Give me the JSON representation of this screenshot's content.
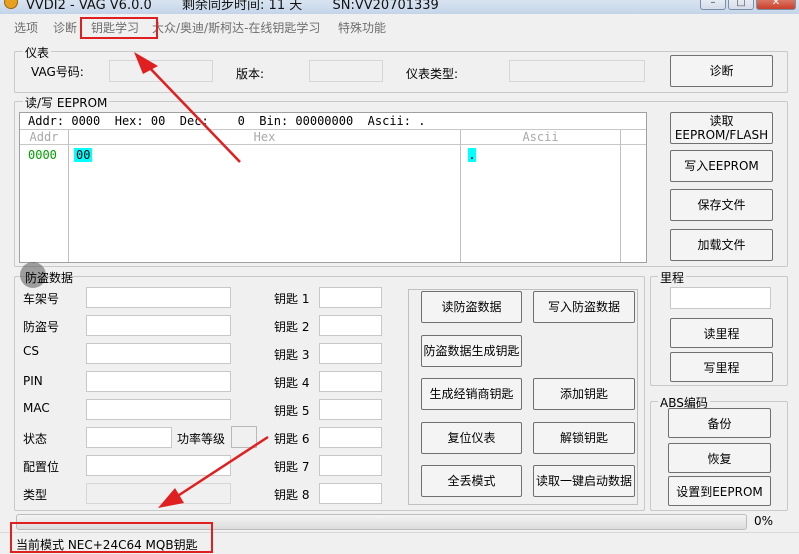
{
  "window": {
    "title": "VVDI2 - VAG V6.0.0",
    "sync_text": "剩余同步时间: 11 天",
    "serial": "SN:VV20701339"
  },
  "menu": [
    {
      "label": "选项"
    },
    {
      "label": "诊断"
    },
    {
      "label": "钥匙学习"
    },
    {
      "label": "大众/奥迪/斯柯达-在线钥匙学习"
    },
    {
      "label": "特殊功能"
    }
  ],
  "instrument": {
    "legend": "仪表",
    "vag_label": "VAG号码:",
    "vag_value": "",
    "version_label": "版本:",
    "version_value": "",
    "type_label": "仪表类型:",
    "type_value": "",
    "diagnose_button": "诊断"
  },
  "eeprom": {
    "legend": "读/写 EEPROM",
    "status": {
      "addr_label": "Addr:",
      "addr": "0000",
      "hex_label": "Hex:",
      "hex": "00",
      "dec_label": "Dec:",
      "dec": "0",
      "bin_label": "Bin:",
      "bin": "00000000",
      "ascii_label": "Ascii:",
      "ascii": "."
    },
    "columns": {
      "addr": "Addr",
      "hex": "Hex",
      "ascii": "Ascii"
    },
    "rows": [
      {
        "addr": "0000",
        "hex": "00",
        "ascii": "."
      }
    ],
    "buttons": {
      "read_line1": "读取",
      "read_line2": "EEPROM/FLASH",
      "write": "写入EEPROM",
      "save": "保存文件",
      "load": "加载文件"
    }
  },
  "immo": {
    "legend": "防盗数据",
    "fields": [
      {
        "label": "车架号",
        "value": ""
      },
      {
        "label": "防盗号",
        "value": ""
      },
      {
        "label": "CS",
        "value": ""
      },
      {
        "label": "PIN",
        "value": ""
      },
      {
        "label": "MAC",
        "value": ""
      },
      {
        "label": "状态",
        "value": ""
      },
      {
        "label": "配置位",
        "value": ""
      },
      {
        "label": "类型",
        "value": ""
      }
    ],
    "power_label": "功率等级",
    "power_value": "",
    "keys": [
      {
        "label": "钥匙 1",
        "value": ""
      },
      {
        "label": "钥匙 2",
        "value": ""
      },
      {
        "label": "钥匙 3",
        "value": ""
      },
      {
        "label": "钥匙 4",
        "value": ""
      },
      {
        "label": "钥匙 5",
        "value": ""
      },
      {
        "label": "钥匙 6",
        "value": ""
      },
      {
        "label": "钥匙 7",
        "value": ""
      },
      {
        "label": "钥匙 8",
        "value": ""
      }
    ],
    "buttons": {
      "read_immo": "读防盗数据",
      "write_immo": "写入防盗数据",
      "gen_key": "防盗数据生成钥匙",
      "gen_dealer_key": "生成经销商钥匙",
      "add_key": "添加钥匙",
      "reset_cluster": "复位仪表",
      "unlock_key": "解锁钥匙",
      "all_keys_lost": "全丢模式",
      "one_click_read": "读取一键启动数据"
    }
  },
  "mileage": {
    "legend": "里程",
    "value": "",
    "read_button": "读里程",
    "write_button": "写里程"
  },
  "abs": {
    "legend": "ABS编码",
    "backup_button": "备份",
    "restore_button": "恢复",
    "set_eeprom_button": "设置到EEPROM"
  },
  "progress": {
    "value": 0,
    "label": "0%"
  },
  "status_bar": {
    "text": "当前模式 NEC+24C64 MQB钥匙"
  },
  "colors": {
    "annotation": "#e02020",
    "addr_green": "#00a000",
    "selection_cyan": "#00ffff"
  }
}
